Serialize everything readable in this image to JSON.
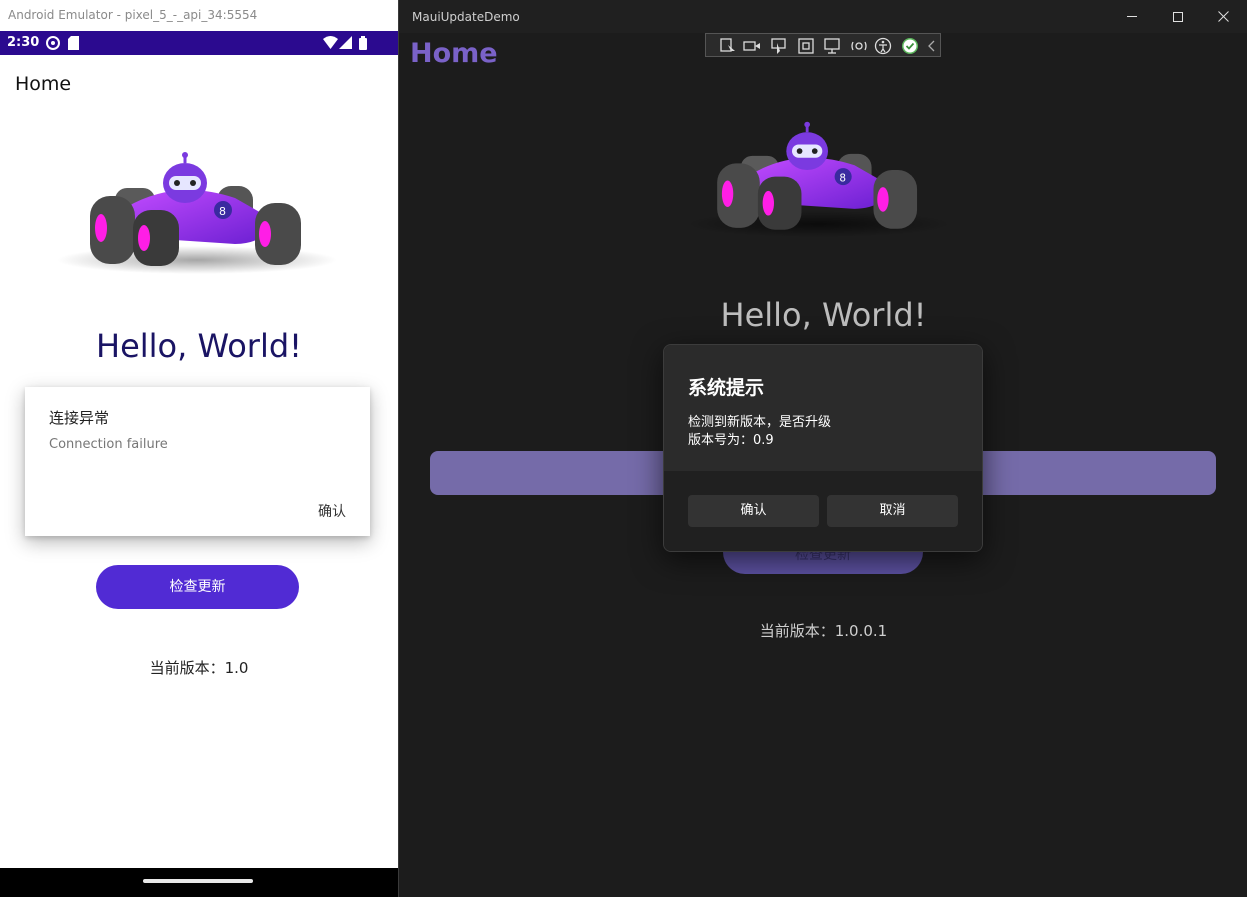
{
  "android": {
    "window_title": "Android Emulator - pixel_5_-_api_34:5554",
    "status": {
      "time": "2:30"
    },
    "app_title": "Home",
    "hello": "Hello, World!",
    "dialog": {
      "title": "连接异常",
      "message": "Connection failure",
      "confirm": "确认"
    },
    "check_button": "检查更新",
    "version": "当前版本：1.0",
    "colors": {
      "status_bar": "#2b0a8f",
      "button": "#512bd4",
      "hello": "#1a1464"
    }
  },
  "windows": {
    "window_title": "MauiUpdateDemo",
    "home_title": "Home",
    "hello": "Hello, World!",
    "toolbar_icons": [
      "select-element-icon",
      "record-icon",
      "pointer-icon",
      "layout-adorner-icon",
      "display-layout-icon",
      "hot-reload-icon",
      "accessibility-icon",
      "ok-check-icon",
      "collapse-chevron-icon"
    ],
    "check_button": "检查更新",
    "version": "当前版本：1.0.0.1",
    "dialog": {
      "title": "系统提示",
      "line1": "检测到新版本，是否升级",
      "line2": "版本号为：0.9",
      "confirm": "确认",
      "cancel": "取消"
    },
    "colors": {
      "background": "#1c1c1c",
      "accent": "#7a62c8",
      "bar": "#756ba9"
    }
  }
}
